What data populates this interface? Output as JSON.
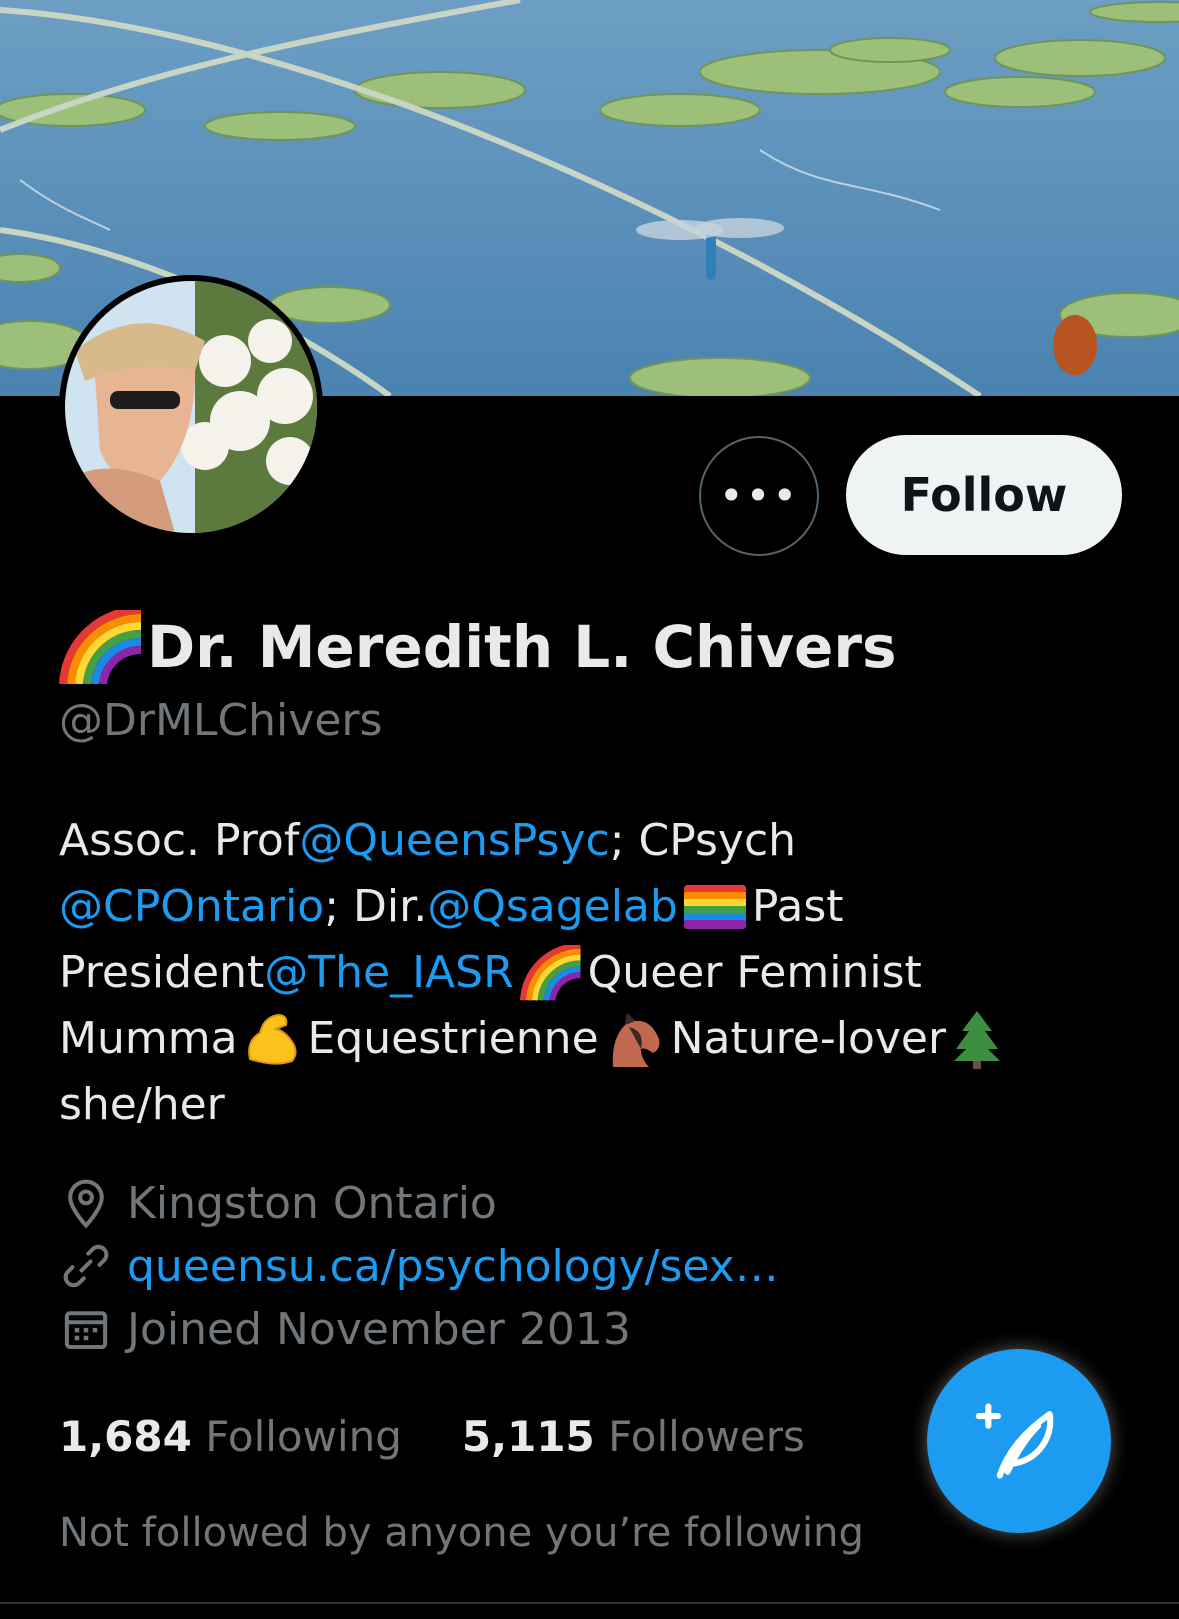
{
  "profile": {
    "display_name": "Dr. Meredith L. Chivers",
    "handle": "@DrMLChivers",
    "actions": {
      "more_label": "•••",
      "follow_label": "Follow"
    },
    "bio": {
      "l1_a": "Assoc. Prof ",
      "l1_mention": "@QueensPsyc",
      "l1_b": "; CPsych",
      "l2_mention": "@CPOntario",
      "l2_a": "; Dir. ",
      "l2_mention2": "@Qsagelab",
      "l2_b": "Past",
      "l3_a": "President ",
      "l3_mention": "@The_IASR",
      "l3_b": " Queer Feminist",
      "l4_a": "Mumma ",
      "l4_b": " Equestrienne",
      "l4_c": " Nature-lover ",
      "l5": "she/her"
    },
    "location": "Kingston Ontario",
    "website": "queensu.ca/psychology/sex…",
    "joined": "Joined November 2013",
    "following_count": "1,684",
    "following_label": "Following",
    "followers_count": "5,115",
    "followers_label": "Followers",
    "followed_by_note": "Not followed by anyone you’re following"
  },
  "icons": {
    "name_emoji": "rainbow-icon",
    "location": "location-pin-icon",
    "website": "link-icon",
    "joined": "calendar-icon",
    "compose": "compose-tweet-icon"
  },
  "colors": {
    "accent": "#1d9bf0",
    "background": "#000000",
    "text": "#e7e9ea",
    "muted": "#71767b"
  }
}
